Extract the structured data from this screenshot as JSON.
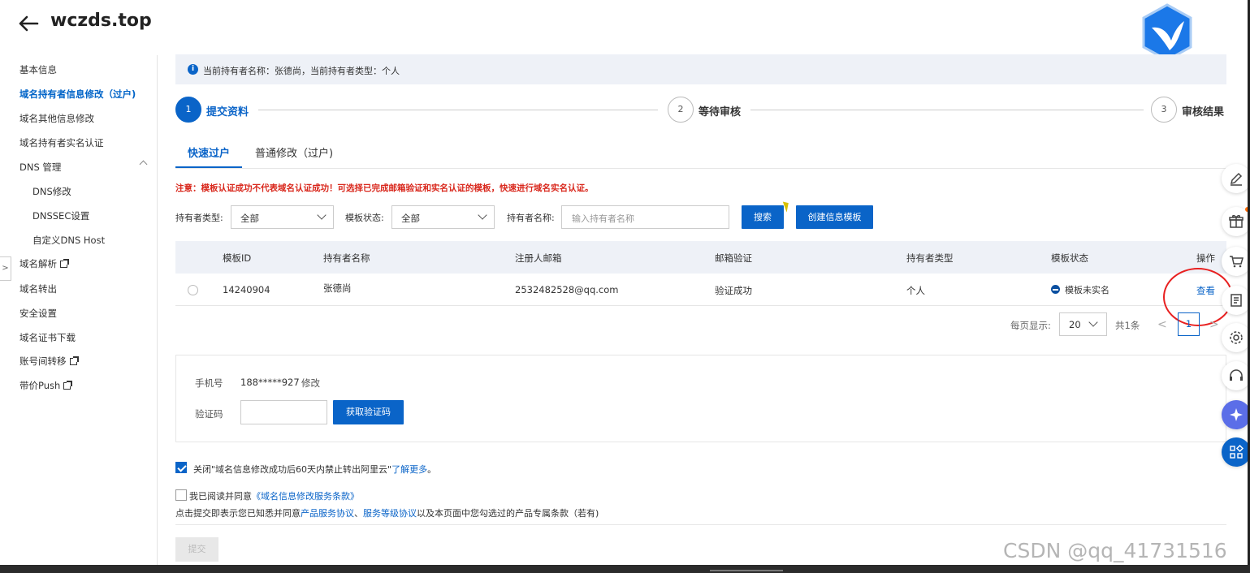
{
  "header": {
    "title": "wczds.top",
    "back_icon": "arrow-left-icon",
    "logo_icon": "bird-shield-logo"
  },
  "sidebar": {
    "items": [
      {
        "label": "基本信息"
      },
      {
        "label": "域名持有者信息修改（过户)",
        "active": true
      },
      {
        "label": "域名其他信息修改"
      },
      {
        "label": "域名持有者实名认证"
      },
      {
        "label": "DNS 管理"
      },
      {
        "label": "DNS修改"
      },
      {
        "label": "DNSSEC设置"
      },
      {
        "label": "自定义DNS Host"
      },
      {
        "label": "域名解析"
      },
      {
        "label": "域名转出"
      },
      {
        "label": "安全设置"
      },
      {
        "label": "域名证书下载"
      },
      {
        "label": "账号间转移"
      },
      {
        "label": "带价Push"
      }
    ],
    "toggle": ">"
  },
  "notice": {
    "text": "当前持有者名称：张德尚，当前持有者类型：个人"
  },
  "steps": [
    {
      "num": "1",
      "label": "提交资料",
      "active": true
    },
    {
      "num": "2",
      "label": "等待审核"
    },
    {
      "num": "3",
      "label": "审核结果"
    }
  ],
  "tabs": [
    {
      "label": "快速过户",
      "active": true
    },
    {
      "label": "普通修改（过户)"
    }
  ],
  "warning": "注意：模板认证成功不代表域名认证成功！可选择已完成邮箱验证和实名认证的模板，快速进行域名实名认证。",
  "filters": {
    "holder_type_label": "持有者类型:",
    "holder_type_value": "全部",
    "template_status_label": "模板状态:",
    "template_status_value": "全部",
    "holder_name_label": "持有者名称:",
    "holder_name_placeholder": "输入持有者名称",
    "search_btn": "搜索",
    "create_btn": "创建信息模板"
  },
  "table": {
    "headers": [
      "模板ID",
      "持有者名称",
      "注册人邮箱",
      "邮箱验证",
      "持有者类型",
      "模板状态",
      "操作"
    ],
    "rows": [
      {
        "id": "14240904",
        "name": "张德尚",
        "email": "2532482528@qq.com",
        "verify": "验证成功",
        "type": "个人",
        "status": "模板未实名",
        "action": "查看"
      }
    ]
  },
  "pagination": {
    "per_page_label": "每页显示:",
    "per_page": "20",
    "total": "共1条",
    "page": "1",
    "prev": "<",
    "next": ">"
  },
  "verify": {
    "phone_label": "手机号",
    "phone": "188*****927",
    "modify": "修改",
    "code_label": "验证码",
    "get_code_btn": "获取验证码"
  },
  "options": {
    "lock_text": "关闭\"域名信息修改成功后60天内禁止转出阿里云\"",
    "learn_more": "了解更多",
    "period": "。",
    "agree_prefix": "我已阅读并同意",
    "agree_link": "《域名信息修改服务条款》",
    "legal_1": "点击提交即表示您已知悉并同意",
    "legal_link1": "产品服务协议",
    "legal_sep": "、",
    "legal_link2": "服务等级协议",
    "legal_2": "以及本页面中您勾选过的产品专属条款（若有)"
  },
  "submit": "提交",
  "floatbar": [
    "edit-icon",
    "gift-icon",
    "cart-icon",
    "document-icon",
    "settings-icon",
    "headset-icon",
    "ai-assistant-icon",
    "apps-icon"
  ],
  "watermark": "CSDN @qq_41731516",
  "colors": {
    "primary": "#0a64c8",
    "warning": "#d9281d",
    "annotation": "#e82020"
  }
}
